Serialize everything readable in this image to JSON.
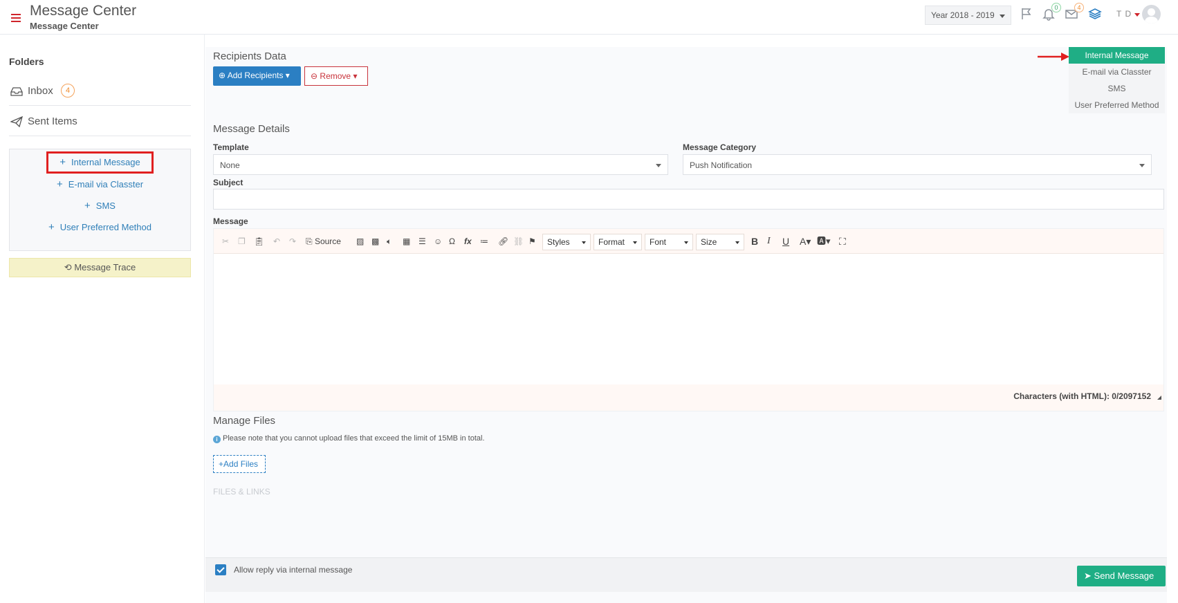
{
  "header": {
    "title": "Message Center",
    "subtitle": "Message Center",
    "year_select": "Year 2018 - 2019",
    "notifications_count": "0",
    "messages_count": "4",
    "user_initials": "T D"
  },
  "sidebar": {
    "folders_title": "Folders",
    "folders": [
      {
        "label": "Inbox",
        "badge": "4"
      },
      {
        "label": "Sent Items"
      }
    ],
    "compose": [
      {
        "label": "Internal Message"
      },
      {
        "label": "E-mail via Classter"
      },
      {
        "label": "SMS"
      },
      {
        "label": "User Preferred Method"
      }
    ],
    "trace_label": "Message Trace"
  },
  "recipients": {
    "title": "Recipients Data",
    "add_label": "Add Recipients",
    "remove_label": "Remove"
  },
  "send_types": [
    {
      "label": "Internal Message",
      "active": true
    },
    {
      "label": "E-mail via Classter",
      "active": false
    },
    {
      "label": "SMS",
      "active": false
    },
    {
      "label": "User Preferred Method",
      "active": false
    }
  ],
  "details": {
    "title": "Message Details",
    "template_label": "Template",
    "template_value": "None",
    "category_label": "Message Category",
    "category_value": "Push Notification",
    "subject_label": "Subject",
    "subject_value": "",
    "message_label": "Message"
  },
  "editor": {
    "source_label": "Source",
    "styles_label": "Styles",
    "format_label": "Format",
    "font_label": "Font",
    "size_label": "Size",
    "char_count": "Characters (with HTML): 0/2097152"
  },
  "files": {
    "title": "Manage Files",
    "note": "Please note that you cannot upload files that exceed the limit of 15MB in total.",
    "add_label": "Add Files",
    "files_links_label": "FILES & LINKS"
  },
  "footer": {
    "allow_reply_label": "Allow reply via internal message",
    "allow_reply_checked": true,
    "send_label": "Send Message"
  },
  "colors": {
    "accent_blue": "#2b7fc3",
    "accent_green": "#1fae85",
    "danger_red": "#c8323a",
    "badge_orange": "#f08a2c"
  }
}
